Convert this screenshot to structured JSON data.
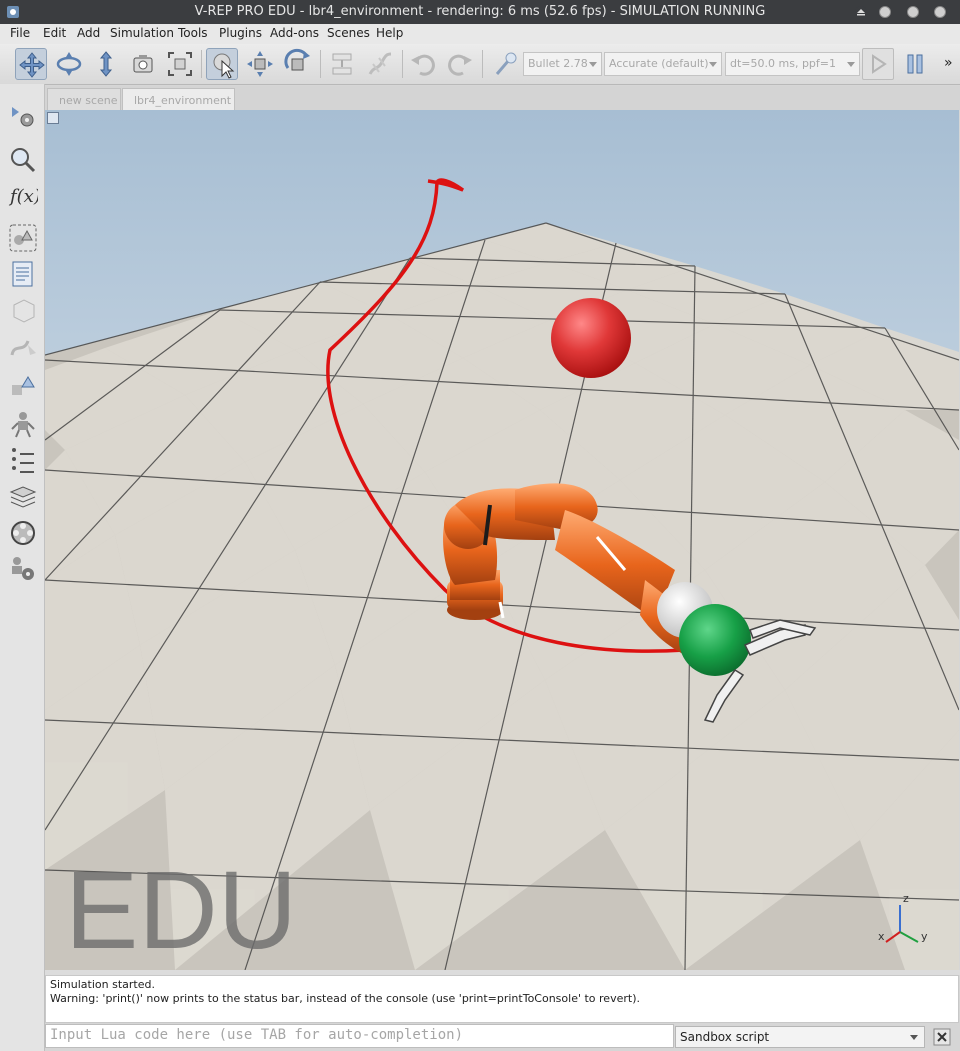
{
  "window": {
    "title": "V-REP PRO EDU - lbr4_environment - rendering: 6 ms (52.6 fps) - SIMULATION RUNNING"
  },
  "menu": [
    "File",
    "Edit",
    "Add",
    "Simulation",
    "Tools",
    "Plugins",
    "Add-ons",
    "Scenes",
    "Help"
  ],
  "toolbar": {
    "engine": "Bullet 2.78",
    "accuracy": "Accurate (default)",
    "timestep": "dt=50.0 ms, ppf=1",
    "overflow": "»",
    "icons": [
      "camera-pan-icon",
      "camera-rotate-icon",
      "camera-shift-icon",
      "camera-angle-icon",
      "camera-fit-icon",
      "click-select-icon",
      "object-shift-icon",
      "object-rotate-icon",
      "assemble-icon",
      "transfer-dna-icon",
      "undo-icon",
      "redo-icon",
      "dynamics-toggle-icon",
      "play-icon",
      "pause-icon"
    ]
  },
  "left_toolbar": {
    "icons": [
      "scene-hierarchy-icon",
      "model-browser-icon",
      "calculation-modules-icon",
      "collections-icon",
      "scripts-icon",
      "shapes-edit-icon",
      "path-edit-icon",
      "selection-icon",
      "user-settings-icon",
      "layers-icon",
      "video-recorder-icon",
      "settings-icon"
    ]
  },
  "tabs": [
    {
      "label": "new scene",
      "active": false
    },
    {
      "label": "lbr4_environment",
      "active": true
    }
  ],
  "viewport": {
    "watermark": "EDU",
    "axes": {
      "x": "x",
      "y": "y",
      "z": "z"
    },
    "colors": {
      "sky_top": "#a7bed3",
      "sky_bottom": "#eef2f5",
      "trajectory": "#dd1111",
      "robot": "#e8651c",
      "target_sphere": "#e03838",
      "tip_sphere": "#17a047"
    }
  },
  "status": {
    "line1": "Simulation started.",
    "line2": "Warning: 'print()' now prints to the status bar, instead of the console (use 'print=printToConsole' to revert)."
  },
  "cmdline": {
    "placeholder": "Input Lua code here (use TAB for auto-completion)"
  },
  "script_selector": {
    "value": "Sandbox script"
  }
}
